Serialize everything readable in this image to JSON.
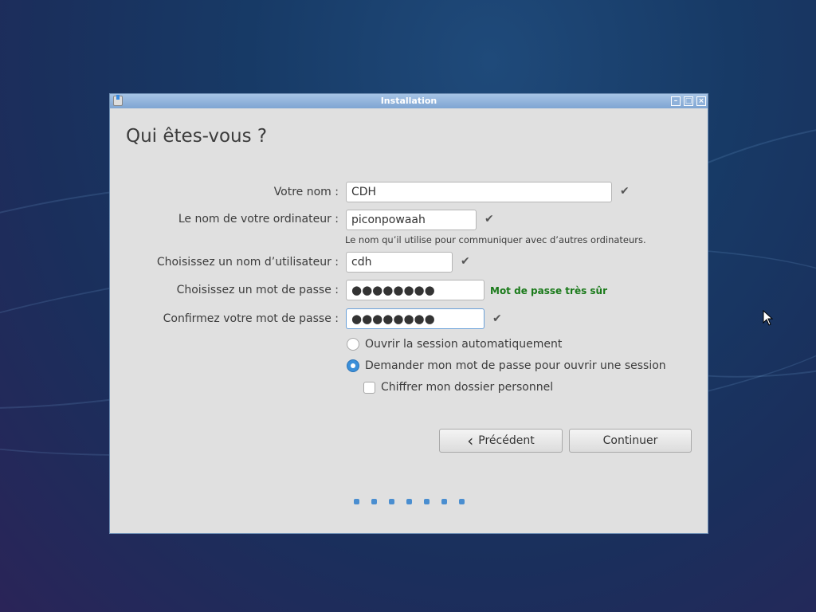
{
  "window": {
    "title": "Installation",
    "minimize": "–",
    "maximize": "□",
    "close": "×"
  },
  "page_title": "Qui êtes-vous ?",
  "fields": {
    "name": {
      "label": "Votre nom :",
      "value": "CDH",
      "check": "✔"
    },
    "computer": {
      "label": "Le nom de votre ordinateur :",
      "value": "piconpowaah",
      "check": "✔",
      "hint": "Le nom qu’il utilise pour communiquer avec d’autres ordinateurs."
    },
    "username": {
      "label": "Choisissez un nom d’utilisateur :",
      "value": "cdh",
      "check": "✔"
    },
    "password": {
      "label": "Choisissez un mot de passe :",
      "value": "●●●●●●●●",
      "strength": "Mot de passe très sûr"
    },
    "confirm": {
      "label": "Confirmez votre mot de passe :",
      "value": "●●●●●●●●",
      "check": "✔"
    }
  },
  "options": {
    "auto_login": {
      "label": "Ouvrir la session automatiquement",
      "selected": false
    },
    "require_password": {
      "label": "Demander mon mot de passe pour ouvrir une session",
      "selected": true
    },
    "encrypt_home": {
      "label": "Chiffrer mon dossier personnel",
      "checked": false
    }
  },
  "buttons": {
    "back": "Précédent",
    "back_icon": "‹",
    "continue": "Continuer"
  },
  "progress": {
    "steps": 7
  }
}
